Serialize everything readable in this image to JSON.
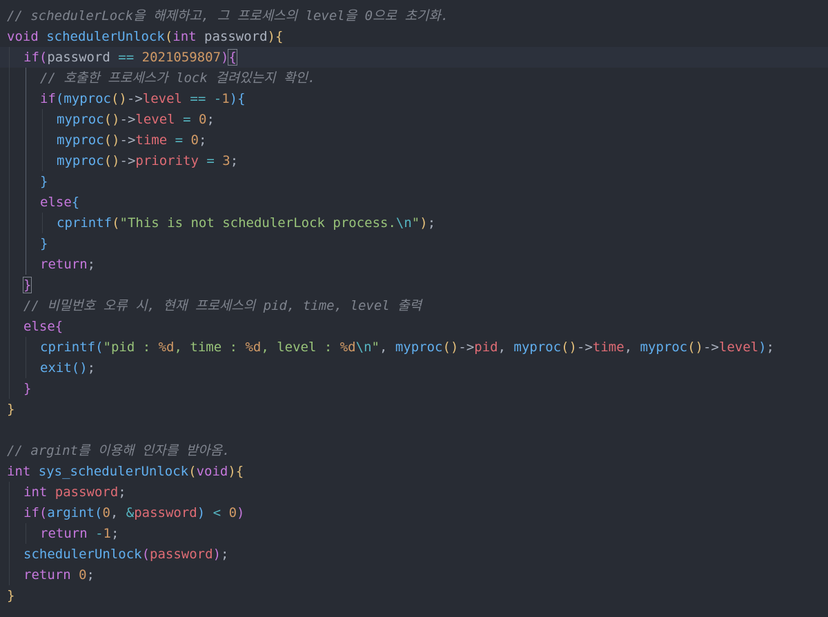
{
  "editor": {
    "theme_colors": {
      "background": "#282c34",
      "keyword": "#c678dd",
      "function": "#61afef",
      "property": "#e06c75",
      "number": "#d19a66",
      "string": "#98c379",
      "comment": "#7f848e",
      "bracket_level_1": "#e5c07b"
    },
    "lines": [
      {
        "indent": 0,
        "tokens": [
          [
            "cm",
            "// schedulerLock을 해제하고, 그 프로세스의 level을 0으로 초기화."
          ]
        ]
      },
      {
        "indent": 0,
        "tokens": [
          [
            "kw",
            "void"
          ],
          [
            "p",
            " "
          ],
          [
            "fn",
            "schedulerUnlock"
          ],
          [
            "b1",
            "("
          ],
          [
            "kw",
            "int"
          ],
          [
            "p",
            " password"
          ],
          [
            "b1",
            ")"
          ],
          [
            "b1",
            "{"
          ]
        ]
      },
      {
        "indent": 1,
        "active": true,
        "tokens": [
          [
            "kw",
            "if"
          ],
          [
            "b2",
            "("
          ],
          [
            "p",
            "password "
          ],
          [
            "op",
            "=="
          ],
          [
            "p",
            " "
          ],
          [
            "num",
            "2021059807"
          ],
          [
            "b2",
            ")"
          ],
          [
            "b2 match",
            "{"
          ]
        ]
      },
      {
        "indent": 2,
        "tokens": [
          [
            "cm",
            "// 호출한 프로세스가 lock 걸려있는지 확인."
          ]
        ]
      },
      {
        "indent": 2,
        "tokens": [
          [
            "kw",
            "if"
          ],
          [
            "b3",
            "("
          ],
          [
            "fn",
            "myproc"
          ],
          [
            "b1",
            "()"
          ],
          [
            "p",
            "->"
          ],
          [
            "prop",
            "level"
          ],
          [
            "p",
            " "
          ],
          [
            "op",
            "=="
          ],
          [
            "p",
            " "
          ],
          [
            "op",
            "-"
          ],
          [
            "num",
            "1"
          ],
          [
            "b3",
            ")"
          ],
          [
            "b3",
            "{"
          ]
        ]
      },
      {
        "indent": 3,
        "tokens": [
          [
            "fn",
            "myproc"
          ],
          [
            "b1",
            "()"
          ],
          [
            "p",
            "->"
          ],
          [
            "prop",
            "level"
          ],
          [
            "p",
            " "
          ],
          [
            "op",
            "="
          ],
          [
            "p",
            " "
          ],
          [
            "num",
            "0"
          ],
          [
            "p",
            ";"
          ]
        ]
      },
      {
        "indent": 3,
        "tokens": [
          [
            "fn",
            "myproc"
          ],
          [
            "b1",
            "()"
          ],
          [
            "p",
            "->"
          ],
          [
            "prop",
            "time"
          ],
          [
            "p",
            " "
          ],
          [
            "op",
            "="
          ],
          [
            "p",
            " "
          ],
          [
            "num",
            "0"
          ],
          [
            "p",
            ";"
          ]
        ]
      },
      {
        "indent": 3,
        "tokens": [
          [
            "fn",
            "myproc"
          ],
          [
            "b1",
            "()"
          ],
          [
            "p",
            "->"
          ],
          [
            "prop",
            "priority"
          ],
          [
            "p",
            " "
          ],
          [
            "op",
            "="
          ],
          [
            "p",
            " "
          ],
          [
            "num",
            "3"
          ],
          [
            "p",
            ";"
          ]
        ]
      },
      {
        "indent": 2,
        "tokens": [
          [
            "b3",
            "}"
          ]
        ]
      },
      {
        "indent": 2,
        "tokens": [
          [
            "kw",
            "else"
          ],
          [
            "b3",
            "{"
          ]
        ]
      },
      {
        "indent": 3,
        "tokens": [
          [
            "fn",
            "cprintf"
          ],
          [
            "b1",
            "("
          ],
          [
            "str",
            "\"This is not schedulerLock process."
          ],
          [
            "esc",
            "\\n"
          ],
          [
            "str",
            "\""
          ],
          [
            "b1",
            ")"
          ],
          [
            "p",
            ";"
          ]
        ]
      },
      {
        "indent": 2,
        "tokens": [
          [
            "b3",
            "}"
          ]
        ]
      },
      {
        "indent": 2,
        "tokens": [
          [
            "kw",
            "return"
          ],
          [
            "p",
            ";"
          ]
        ]
      },
      {
        "indent": 1,
        "tokens": [
          [
            "b2 match",
            "}"
          ]
        ]
      },
      {
        "indent": 1,
        "tokens": [
          [
            "cm",
            "// 비밀번호 오류 시, 현재 프로세스의 pid, time, level 출력"
          ]
        ]
      },
      {
        "indent": 1,
        "tokens": [
          [
            "kw",
            "else"
          ],
          [
            "b2",
            "{"
          ]
        ]
      },
      {
        "indent": 2,
        "tokens": [
          [
            "fn",
            "cprintf"
          ],
          [
            "b3",
            "("
          ],
          [
            "str",
            "\"pid : "
          ],
          [
            "num",
            "%d"
          ],
          [
            "str",
            ", time : "
          ],
          [
            "num",
            "%d"
          ],
          [
            "str",
            ", level : "
          ],
          [
            "num",
            "%d"
          ],
          [
            "esc",
            "\\n"
          ],
          [
            "str",
            "\""
          ],
          [
            "p",
            ", "
          ],
          [
            "fn",
            "myproc"
          ],
          [
            "b1",
            "()"
          ],
          [
            "p",
            "->"
          ],
          [
            "prop",
            "pid"
          ],
          [
            "p",
            ", "
          ],
          [
            "fn",
            "myproc"
          ],
          [
            "b1",
            "()"
          ],
          [
            "p",
            "->"
          ],
          [
            "prop",
            "time"
          ],
          [
            "p",
            ", "
          ],
          [
            "fn",
            "myproc"
          ],
          [
            "b1",
            "()"
          ],
          [
            "p",
            "->"
          ],
          [
            "prop",
            "level"
          ],
          [
            "b3",
            ")"
          ],
          [
            "p",
            ";"
          ]
        ]
      },
      {
        "indent": 2,
        "tokens": [
          [
            "fn",
            "exit"
          ],
          [
            "b3",
            "()"
          ],
          [
            "p",
            ";"
          ]
        ]
      },
      {
        "indent": 1,
        "tokens": [
          [
            "b2",
            "}"
          ]
        ]
      },
      {
        "indent": 0,
        "tokens": [
          [
            "b1",
            "}"
          ]
        ]
      },
      {
        "indent": 0,
        "tokens": []
      },
      {
        "indent": 0,
        "tokens": [
          [
            "cm",
            "// argint를 이용해 인자를 받아옴."
          ]
        ]
      },
      {
        "indent": 0,
        "tokens": [
          [
            "kw",
            "int"
          ],
          [
            "p",
            " "
          ],
          [
            "fn",
            "sys_schedulerUnlock"
          ],
          [
            "b1",
            "("
          ],
          [
            "kw",
            "void"
          ],
          [
            "b1",
            ")"
          ],
          [
            "b1",
            "{"
          ]
        ]
      },
      {
        "indent": 1,
        "tokens": [
          [
            "kw",
            "int"
          ],
          [
            "p",
            " "
          ],
          [
            "prop",
            "password"
          ],
          [
            "p",
            ";"
          ]
        ]
      },
      {
        "indent": 1,
        "tokens": [
          [
            "kw",
            "if"
          ],
          [
            "b2",
            "("
          ],
          [
            "fn",
            "argint"
          ],
          [
            "b3",
            "("
          ],
          [
            "num",
            "0"
          ],
          [
            "p",
            ", "
          ],
          [
            "op",
            "&"
          ],
          [
            "prop",
            "password"
          ],
          [
            "b3",
            ")"
          ],
          [
            "p",
            " "
          ],
          [
            "op",
            "<"
          ],
          [
            "p",
            " "
          ],
          [
            "num",
            "0"
          ],
          [
            "b2",
            ")"
          ]
        ]
      },
      {
        "indent": 2,
        "tokens": [
          [
            "kw",
            "return"
          ],
          [
            "p",
            " "
          ],
          [
            "op",
            "-"
          ],
          [
            "num",
            "1"
          ],
          [
            "p",
            ";"
          ]
        ]
      },
      {
        "indent": 1,
        "tokens": [
          [
            "fn",
            "schedulerUnlock"
          ],
          [
            "b2",
            "("
          ],
          [
            "prop",
            "password"
          ],
          [
            "b2",
            ")"
          ],
          [
            "p",
            ";"
          ]
        ]
      },
      {
        "indent": 1,
        "tokens": [
          [
            "kw",
            "return"
          ],
          [
            "p",
            " "
          ],
          [
            "num",
            "0"
          ],
          [
            "p",
            ";"
          ]
        ]
      },
      {
        "indent": 0,
        "tokens": [
          [
            "b1",
            "}"
          ]
        ]
      }
    ]
  }
}
